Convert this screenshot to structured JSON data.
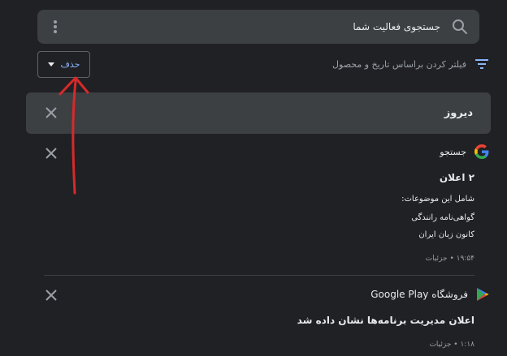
{
  "search": {
    "placeholder_text": "جستجوی فعالیت شما"
  },
  "toolbar": {
    "delete_label": "حذف",
    "filter_label": "فیلتر کردن براساس تاریخ و محصول"
  },
  "day_group": {
    "title": "دیروز"
  },
  "entries": [
    {
      "source": "جستجو",
      "source_icon": "google-g-icon",
      "heading": "۲ اعلان",
      "topics_label": "شامل این موضوعات:",
      "topics": [
        "گواهی‌نامه رانندگی",
        "کانون زبان ایران"
      ],
      "meta": "۱۹:۵۴ • جزئیات"
    },
    {
      "source": "فروشگاه Google Play",
      "source_icon": "google-play-icon",
      "heading": "اعلان مدیریت برنامه‌ها نشان داده شد",
      "meta": "۱:۱۸ • جزئیات"
    }
  ],
  "colors": {
    "background": "#202124",
    "surface": "#3c4043",
    "accent": "#8ab4f8",
    "annotation_arrow": "#d62a2a"
  }
}
